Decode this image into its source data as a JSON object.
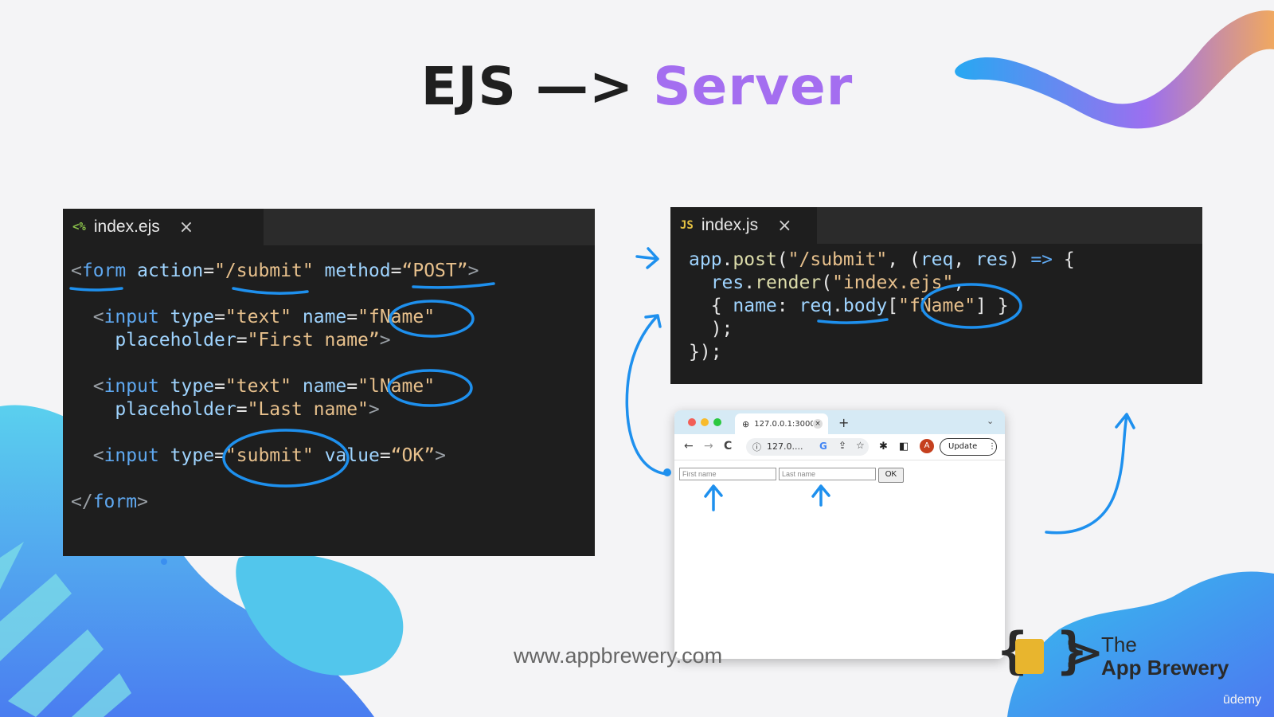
{
  "slide": {
    "title_part1": "EJS —> ",
    "title_part2": "Server",
    "watermark": "www.appbrewery.com",
    "brand_line1": "The",
    "brand_line2": "App Brewery",
    "platform": "ūdemy"
  },
  "left_editor": {
    "tab_icon": "<%",
    "tab_label": "index.ejs",
    "close_glyph": "×",
    "lines": [
      [
        [
          "p",
          "<"
        ],
        [
          "k",
          "form"
        ],
        [
          "w",
          " "
        ],
        [
          "a",
          "action"
        ],
        [
          "w",
          "="
        ],
        [
          "s",
          "\"/submit\""
        ],
        [
          "w",
          " "
        ],
        [
          "a",
          "method"
        ],
        [
          "w",
          "="
        ],
        [
          "s",
          "“POST”"
        ],
        [
          "p",
          ">"
        ]
      ],
      [
        [
          "w",
          ""
        ]
      ],
      [
        [
          "w",
          "  "
        ],
        [
          "p",
          "<"
        ],
        [
          "k",
          "input"
        ],
        [
          "w",
          " "
        ],
        [
          "a",
          "type"
        ],
        [
          "w",
          "="
        ],
        [
          "s",
          "\"text\""
        ],
        [
          "w",
          " "
        ],
        [
          "a",
          "name"
        ],
        [
          "w",
          "="
        ],
        [
          "s",
          "\"fName\""
        ]
      ],
      [
        [
          "w",
          "    "
        ],
        [
          "a",
          "placeholder"
        ],
        [
          "w",
          "="
        ],
        [
          "s",
          "\"First name”"
        ],
        [
          "p",
          ">"
        ]
      ],
      [
        [
          "w",
          ""
        ]
      ],
      [
        [
          "w",
          "  "
        ],
        [
          "p",
          "<"
        ],
        [
          "k",
          "input"
        ],
        [
          "w",
          " "
        ],
        [
          "a",
          "type"
        ],
        [
          "w",
          "="
        ],
        [
          "s",
          "\"text\""
        ],
        [
          "w",
          " "
        ],
        [
          "a",
          "name"
        ],
        [
          "w",
          "="
        ],
        [
          "s",
          "\"lName\""
        ]
      ],
      [
        [
          "w",
          "    "
        ],
        [
          "a",
          "placeholder"
        ],
        [
          "w",
          "="
        ],
        [
          "s",
          "\"Last name\""
        ],
        [
          "p",
          ">"
        ]
      ],
      [
        [
          "w",
          ""
        ]
      ],
      [
        [
          "w",
          "  "
        ],
        [
          "p",
          "<"
        ],
        [
          "k",
          "input"
        ],
        [
          "w",
          " "
        ],
        [
          "a",
          "type"
        ],
        [
          "w",
          "="
        ],
        [
          "s",
          "\"submit\""
        ],
        [
          "w",
          " "
        ],
        [
          "a",
          "value"
        ],
        [
          "w",
          "="
        ],
        [
          "s",
          "“OK”"
        ],
        [
          "p",
          ">"
        ]
      ],
      [
        [
          "w",
          ""
        ]
      ],
      [
        [
          "p",
          "</"
        ],
        [
          "k",
          "form"
        ],
        [
          "p",
          ">"
        ]
      ]
    ]
  },
  "right_editor": {
    "tab_icon": "JS",
    "tab_label": "index.js",
    "close_glyph": "×",
    "lines": [
      [
        [
          "a",
          "app"
        ],
        [
          "w",
          "."
        ],
        [
          "f",
          "post"
        ],
        [
          "w",
          "("
        ],
        [
          "s",
          "\"/submit\""
        ],
        [
          "w",
          ", ("
        ],
        [
          "a",
          "req"
        ],
        [
          "w",
          ", "
        ],
        [
          "a",
          "res"
        ],
        [
          "w",
          ") "
        ],
        [
          "k",
          "=>"
        ],
        [
          "w",
          " {"
        ]
      ],
      [
        [
          "w",
          "  "
        ],
        [
          "a",
          "res"
        ],
        [
          "w",
          "."
        ],
        [
          "f",
          "render"
        ],
        [
          "w",
          "("
        ],
        [
          "s",
          "\"index.ejs\""
        ],
        [
          "w",
          ","
        ]
      ],
      [
        [
          "w",
          "  { "
        ],
        [
          "a",
          "name"
        ],
        [
          "w",
          ": "
        ],
        [
          "a",
          "req"
        ],
        [
          "w",
          "."
        ],
        [
          "a",
          "body"
        ],
        [
          "w",
          "["
        ],
        [
          "s",
          "\"fName\""
        ],
        [
          "w",
          "] }"
        ]
      ],
      [
        [
          "w",
          "  );"
        ]
      ],
      [
        [
          "w",
          "});"
        ]
      ]
    ]
  },
  "browser": {
    "tab_title": "127.0.0.1:3000",
    "tab_close": "×",
    "new_tab": "+",
    "tab_menu": "⌄",
    "back": "←",
    "forward": "→",
    "reload": "C",
    "info_icon": "ⓘ",
    "address": "127.0....",
    "google_icon": "G",
    "share_icon": "⇪",
    "bookmark_icon": "☆",
    "extensions_icon": "✱",
    "sidepanel_icon": "◧",
    "avatar_letter": "A",
    "update_label": "Update",
    "menu_icon": "⋮",
    "first_placeholder": "First name",
    "last_placeholder": "Last name",
    "submit_value": "OK"
  },
  "colors": {
    "accent_purple": "#a46ef0",
    "annotation_blue": "#1e90ee",
    "editor_bg": "#1e1e1e",
    "blob_cyan": "#3cc6e8"
  }
}
